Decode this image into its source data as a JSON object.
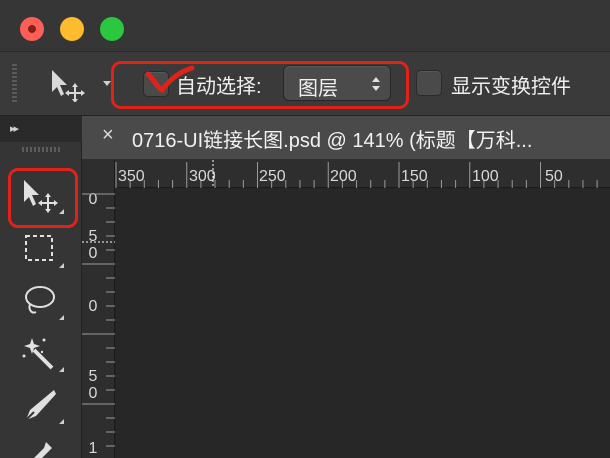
{
  "window": {
    "traffic_lights": [
      "close",
      "minimize",
      "zoom"
    ],
    "colors": {
      "close": "#fc5f57",
      "minimize": "#fdbb2e",
      "zoom": "#29c83f"
    }
  },
  "options_bar": {
    "tool_preset_icon": "move-tool-icon",
    "auto_select": {
      "label": "自动选择:",
      "checked": true
    },
    "auto_select_target": {
      "value": "图层"
    },
    "show_transform_controls": {
      "label": "显示变换控件",
      "checked": false
    },
    "highlight_color": "#e0231a"
  },
  "document_tab": {
    "close_glyph": "×",
    "title": "0716-UI链接长图.psd @ 141% (标题【万科..."
  },
  "rulers": {
    "horizontal_labels": [
      "350",
      "300",
      "250",
      "200",
      "150",
      "100",
      "50"
    ],
    "vertical_labels": [
      "0",
      "5\n0",
      "0",
      "5\n0",
      "1"
    ]
  },
  "toolbar": {
    "collapse_glyph": "▸▸",
    "tools": [
      "move-tool",
      "marquee-tool",
      "lasso-tool",
      "magic-wand-tool",
      "pen-tool",
      "eyedropper-tool"
    ],
    "active_tool": "move-tool"
  }
}
